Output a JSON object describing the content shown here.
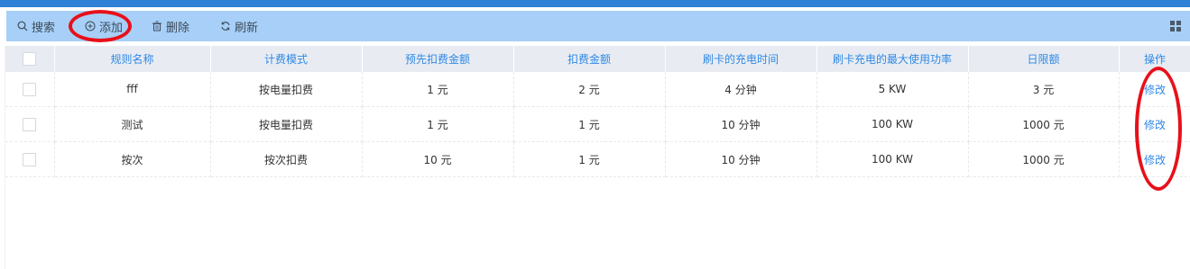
{
  "colors": {
    "top_bar": "#2f80d6",
    "toolbar_bg": "#a7cff7",
    "header_bg": "#e8ecf2",
    "link": "#2f88e6",
    "annotation": "#e8101a"
  },
  "toolbar": {
    "search_label": "搜索",
    "search_icon": "search-icon",
    "add_label": "添加",
    "add_icon": "plus-circle-icon",
    "delete_label": "删除",
    "delete_icon": "trash-icon",
    "refresh_label": "刷新",
    "refresh_icon": "refresh-icon",
    "grid_icon": "grid-icon"
  },
  "table": {
    "columns": [
      "规则名称",
      "计费模式",
      "预先扣费金额",
      "扣费金额",
      "刷卡的充电时间",
      "刷卡充电的最大使用功率",
      "日限额",
      "操作"
    ],
    "rows": [
      {
        "name": "fff",
        "mode": "按电量扣费",
        "prepay": "1 元",
        "charge": "2 元",
        "time": "4 分钟",
        "power": "5 KW",
        "daily_limit": "3 元",
        "action": "修改"
      },
      {
        "name": "测试",
        "mode": "按电量扣费",
        "prepay": "1 元",
        "charge": "1 元",
        "time": "10 分钟",
        "power": "100 KW",
        "daily_limit": "1000 元",
        "action": "修改"
      },
      {
        "name": "按次",
        "mode": "按次扣费",
        "prepay": "10 元",
        "charge": "1 元",
        "time": "10 分钟",
        "power": "100 KW",
        "daily_limit": "1000 元",
        "action": "修改"
      }
    ]
  }
}
